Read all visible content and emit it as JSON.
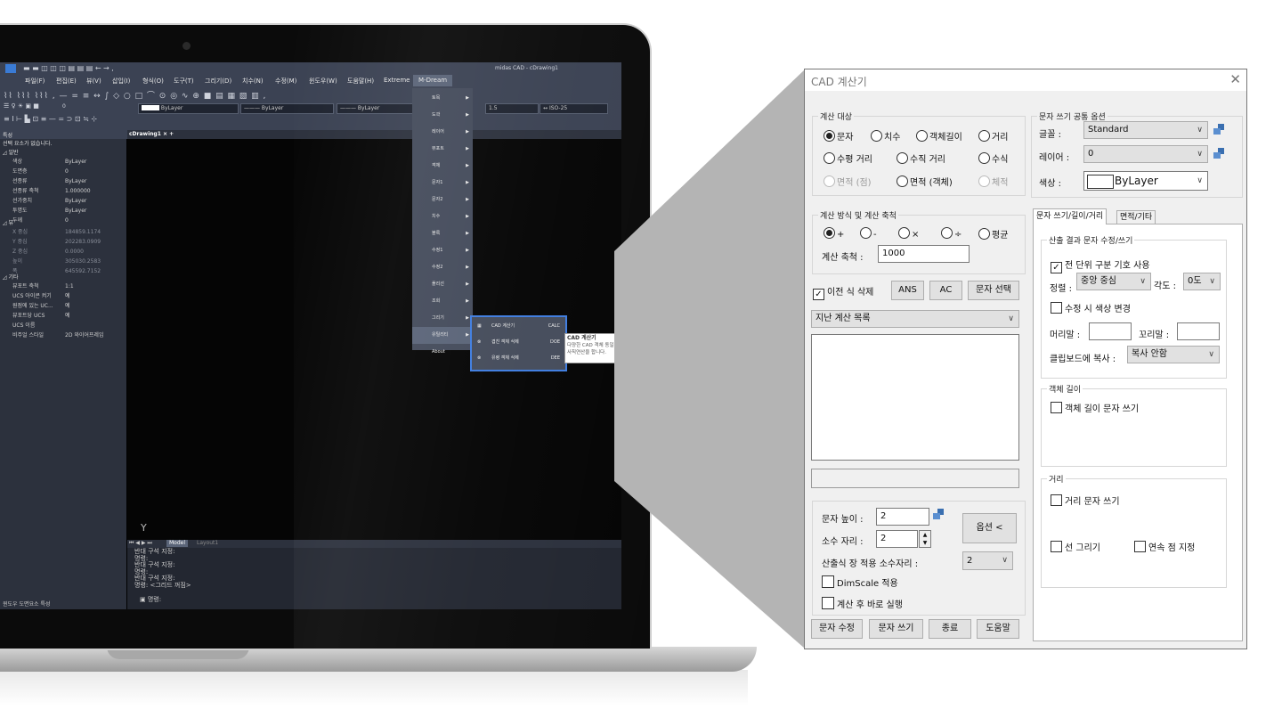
{
  "laptop": {
    "app_title": "midas CAD - cDrawing1",
    "menus": [
      "파일(F)",
      "편집(E)",
      "뷰(V)",
      "삽입(I)",
      "형식(O)",
      "도구(T)",
      "그리기(D)",
      "치수(N)",
      "수정(M)",
      "윈도우(W)",
      "도움말(H)",
      "Extreme",
      "M-Dream"
    ],
    "layer_value": "ByLayer",
    "linetype_value": "ByLayer",
    "lineweight_value": "ByLayer",
    "scale_value": "1.5",
    "dim_style": "ISO-25",
    "doc_tab": "cDrawing1",
    "layer_name": "0",
    "properties": {
      "header": "특성",
      "no_selection": "선택 요소가 없습니다.",
      "section_general": "일반",
      "section_view": "뷰",
      "section_misc": "기타",
      "general": [
        {
          "k": "색상",
          "v": "ByLayer"
        },
        {
          "k": "도면층",
          "v": "0"
        },
        {
          "k": "선종류",
          "v": "ByLayer"
        },
        {
          "k": "선종류 축척",
          "v": "1.000000"
        },
        {
          "k": "선가중치",
          "v": "ByLayer"
        },
        {
          "k": "투명도",
          "v": "ByLayer"
        },
        {
          "k": "두께",
          "v": "0"
        }
      ],
      "view": [
        {
          "k": "X 중심",
          "v": "184859.1174"
        },
        {
          "k": "Y 중심",
          "v": "202283.0909"
        },
        {
          "k": "Z 중심",
          "v": "0.0000"
        },
        {
          "k": "높이",
          "v": "305030.2583"
        },
        {
          "k": "폭",
          "v": "645592.7152"
        }
      ],
      "misc": [
        {
          "k": "뷰포트 축척",
          "v": "1:1"
        },
        {
          "k": "UCS 아이콘 켜기",
          "v": "예"
        },
        {
          "k": "원점에 있는 UC...",
          "v": "예"
        },
        {
          "k": "뷰포트당 UCS",
          "v": "예"
        },
        {
          "k": "UCS 이름",
          "v": ""
        },
        {
          "k": "비주얼 스타일",
          "v": "2D 와이어프레임"
        }
      ]
    },
    "status_tabs": "윈도우 도면요소 특성",
    "mdream_menu": [
      "토목",
      "도곽",
      "레이어",
      "뷰포트",
      "객체",
      "문자1",
      "문자2",
      "치수",
      "블록",
      "수정1",
      "수정2",
      "폴리선",
      "조회",
      "그리기",
      "유틸리티",
      "About"
    ],
    "submenu": [
      {
        "label": "CAD 계산기",
        "cmd": "CALC"
      },
      {
        "label": "겹친 객체 삭제",
        "cmd": "DOE"
      },
      {
        "label": "유령 객체 삭제",
        "cmd": "DEE"
      }
    ],
    "tooltip": {
      "title": "CAD 계산기",
      "body": "다양한 CAD 객체 동일 사칙연산을 합니다."
    },
    "ucs_y": "Y",
    "ucs_x": "X",
    "model_tab": "Model",
    "layout_tab": "Layout1",
    "command_lines": [
      "반대 구석 지정:",
      "명령:",
      "반대 구석 지정:",
      "명령:",
      "반대 구석 지정:",
      "명령: <그리드 꺼짐>"
    ],
    "prompt": "명령:"
  },
  "dialog": {
    "title": "CAD 계산기",
    "close_glyph": "✕",
    "calc_target": {
      "title": "계산 대상",
      "options": [
        {
          "label": "문자",
          "selected": true,
          "disabled": false
        },
        {
          "label": "치수",
          "selected": false,
          "disabled": false
        },
        {
          "label": "객체길이",
          "selected": false,
          "disabled": false
        },
        {
          "label": "거리",
          "selected": false,
          "disabled": false
        },
        {
          "label": "수평 거리",
          "selected": false,
          "disabled": false
        },
        {
          "label": "수직 거리",
          "selected": false,
          "disabled": false
        },
        {
          "label": "수식",
          "selected": false,
          "disabled": false
        },
        {
          "label": "면적 (점)",
          "selected": false,
          "disabled": true
        },
        {
          "label": "면적 (객체)",
          "selected": false,
          "disabled": false
        },
        {
          "label": "체적",
          "selected": false,
          "disabled": true
        }
      ]
    },
    "calc_method": {
      "title": "계산 방식 및 계산 축척",
      "ops": [
        {
          "label": "+",
          "selected": true
        },
        {
          "label": "-",
          "selected": false
        },
        {
          "label": "×",
          "selected": false
        },
        {
          "label": "÷",
          "selected": false
        },
        {
          "label": "평균",
          "selected": false
        }
      ],
      "scale_label": "계산 축척 :",
      "scale_value": "1000"
    },
    "prev_delete_label": "이전 식 삭제",
    "prev_delete_checked": true,
    "ans_label": "ANS",
    "ac_label": "AC",
    "select_text_label": "문자 선택",
    "history_label": "지난 계산 목록",
    "text_height_label": "문자 높이 :",
    "text_height_value": "2",
    "decimal_label": "소수 자리 :",
    "decimal_value": "2",
    "options_button": "옵션 <",
    "formula_decimal_label": "산출식 장 적용 소수자리 :",
    "formula_decimal_value": "2",
    "dimscale_label": "DimScale 적용",
    "run_after_label": "계산 후 바로 실행",
    "buttons": {
      "edit": "문자 수정",
      "write": "문자 쓰기",
      "close": "종료",
      "help": "도움말"
    },
    "common": {
      "title": "문자 쓰기 공통 옵션",
      "font_label": "글꼴 :",
      "font_value": "Standard",
      "layer_label": "레이어 :",
      "layer_value": "0",
      "color_label": "색상 :",
      "color_value": "ByLayer"
    },
    "tabs": [
      "문자 쓰기/길이/거리",
      "면적/기타"
    ],
    "result_group": {
      "title": "산출 결과 문자 수정/쓰기",
      "unit_symbol_label": "전 단위 구분 기호 사용",
      "align_label": "정렬 :",
      "align_value": "중앙 중심",
      "angle_label": "각도 :",
      "angle_value": "0도",
      "color_change_label": "수정 시 색상 변경",
      "prefix_label": "머리말 :",
      "suffix_label": "꼬리말 :",
      "clipboard_label": "클립보드에 복사 :",
      "clipboard_value": "복사 안함"
    },
    "length_group": {
      "title": "객체 길이",
      "write_label": "객체 길이 문자 쓰기"
    },
    "distance_group": {
      "title": "거리",
      "write_label": "거리 문자 쓰기",
      "line_label": "선 그리기",
      "continuous_label": "연속 점 지정"
    }
  }
}
